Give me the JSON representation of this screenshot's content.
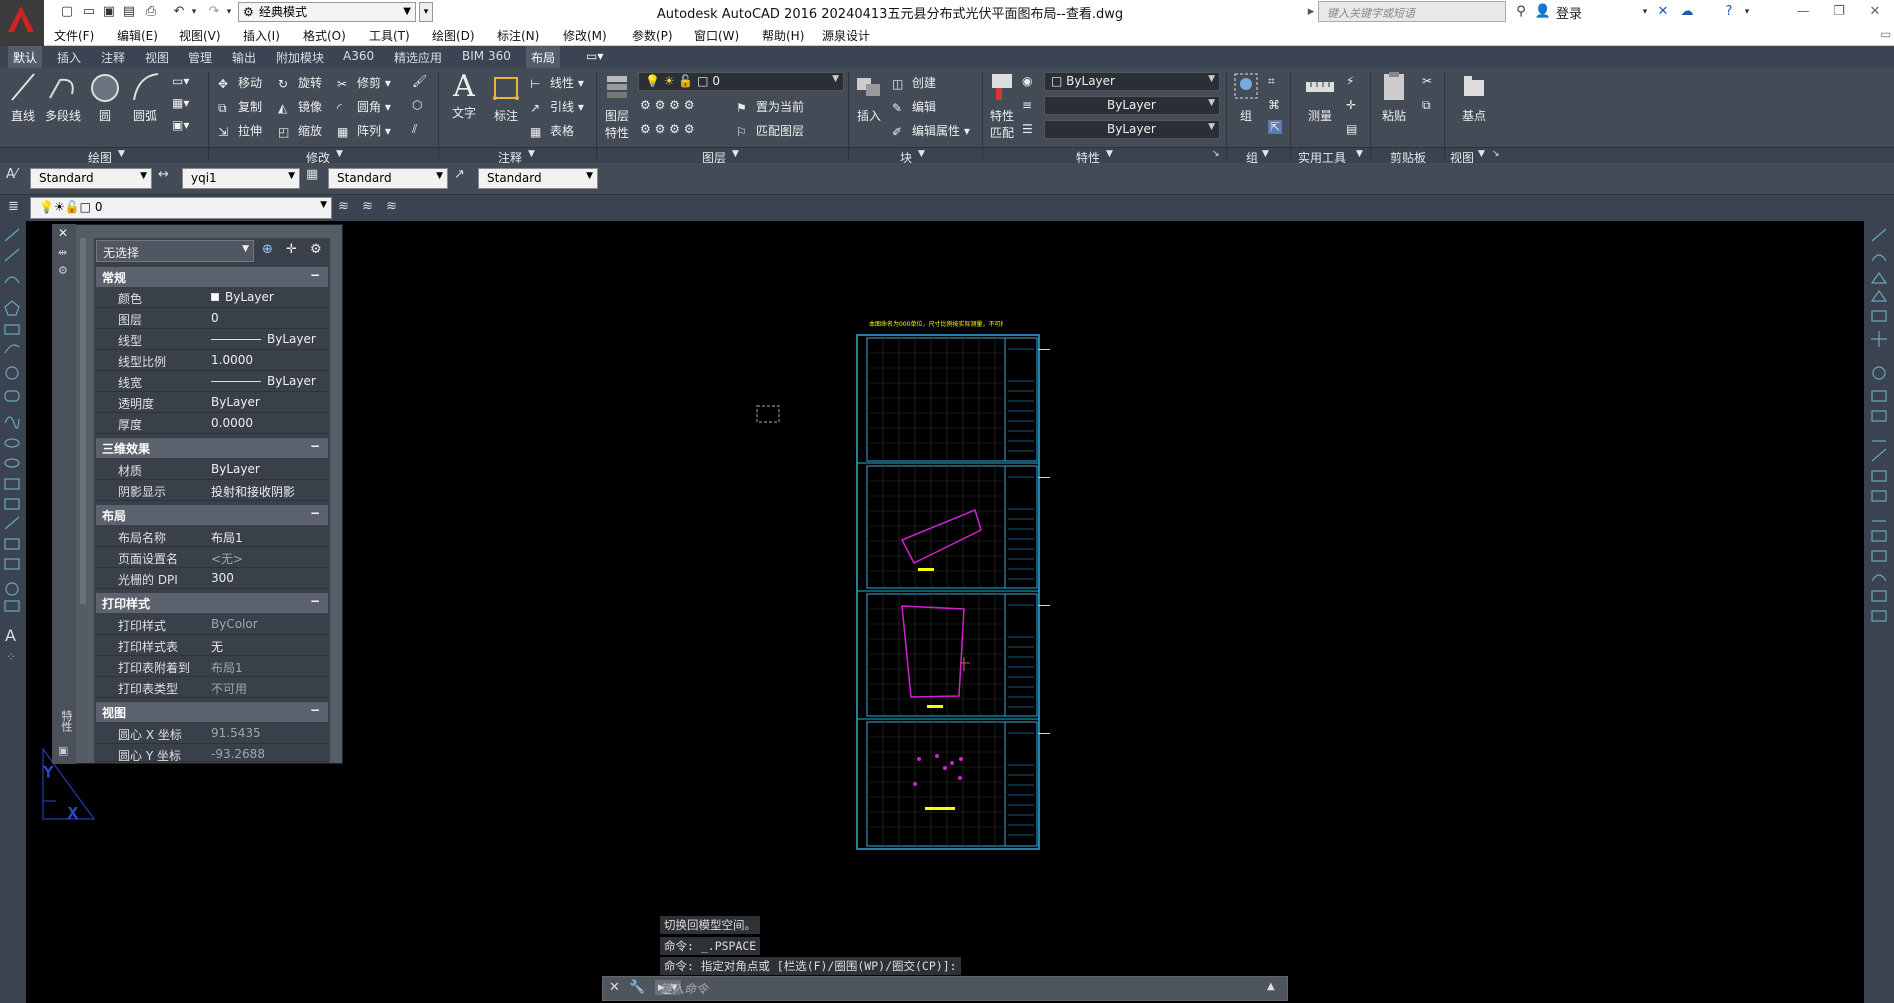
{
  "title_bar": {
    "workspace": "经典模式",
    "window_title": "Autodesk AutoCAD 2016    20240413五元县分布式光伏平面图布局--查看.dwg",
    "search_placeholder": "键入关键字或短语",
    "login": "登录"
  },
  "menu": [
    "文件(F)",
    "编辑(E)",
    "视图(V)",
    "插入(I)",
    "格式(O)",
    "工具(T)",
    "绘图(D)",
    "标注(N)",
    "修改(M)",
    "参数(P)",
    "窗口(W)",
    "帮助(H)",
    "源泉设计"
  ],
  "ribbon_tabs": [
    "默认",
    "插入",
    "注释",
    "视图",
    "管理",
    "输出",
    "附加模块",
    "A360",
    "精选应用",
    "BIM 360",
    "布局"
  ],
  "ribbon": {
    "draw": {
      "line": "直线",
      "polyline": "多段线",
      "circle": "圆",
      "arc": "圆弧",
      "group": "绘图"
    },
    "modify": {
      "move": "移动",
      "rotate": "旋转",
      "trim": "修剪",
      "copy": "复制",
      "mirror": "镜像",
      "fillet": "圆角",
      "stretch": "拉伸",
      "scale": "缩放",
      "array": "阵列",
      "group": "修改"
    },
    "annotation": {
      "text": "文字",
      "dimension": "标注",
      "linear": "线性",
      "leader": "引线",
      "table": "表格",
      "group": "注释"
    },
    "layers": {
      "layer_props": "图层",
      "layer_props2": "特性",
      "current_layer": "0",
      "make_current": "置为当前",
      "match_layer": "匹配图层",
      "group": "图层"
    },
    "block": {
      "insert": "插入",
      "create": "创建",
      "edit": "编辑",
      "edit_attr": "编辑属性",
      "group": "块"
    },
    "properties": {
      "match": "特性",
      "match2": "匹配",
      "color": "ByLayer",
      "linetype": "ByLayer",
      "lineweight": "ByLayer",
      "group": "特性"
    },
    "groups": {
      "group": "组",
      "group_label": "组"
    },
    "utilities": {
      "measure": "测量",
      "group": "实用工具"
    },
    "clipboard": {
      "paste": "粘贴",
      "group": "剪贴板"
    },
    "view": {
      "base": "基点",
      "group": "视图"
    }
  },
  "style_bar": {
    "text_style": "Standard",
    "dim_style": "yqi1",
    "table_style": "Standard",
    "mleader_style": "Standard"
  },
  "layer_bar": {
    "layer": "0"
  },
  "properties_panel": {
    "selection": "无选择",
    "sections": [
      {
        "name": "常规",
        "rows": [
          {
            "k": "颜色",
            "v": "ByLayer"
          },
          {
            "k": "图层",
            "v": "0"
          },
          {
            "k": "线型",
            "v": "ByLayer"
          },
          {
            "k": "线型比例",
            "v": "1.0000"
          },
          {
            "k": "线宽",
            "v": "ByLayer"
          },
          {
            "k": "透明度",
            "v": "ByLayer"
          },
          {
            "k": "厚度",
            "v": "0.0000"
          }
        ]
      },
      {
        "name": "三维效果",
        "rows": [
          {
            "k": "材质",
            "v": "ByLayer"
          },
          {
            "k": "阴影显示",
            "v": "投射和接收阴影"
          }
        ]
      },
      {
        "name": "布局",
        "rows": [
          {
            "k": "布局名称",
            "v": "布局1"
          },
          {
            "k": "页面设置名",
            "v": "<无>"
          },
          {
            "k": "光栅的 DPI",
            "v": "300"
          }
        ]
      },
      {
        "name": "打印样式",
        "rows": [
          {
            "k": "打印样式",
            "v": "ByColor"
          },
          {
            "k": "打印样式表",
            "v": "无"
          },
          {
            "k": "打印表附着到",
            "v": "布局1"
          },
          {
            "k": "打印表类型",
            "v": "不可用"
          }
        ]
      },
      {
        "name": "视图",
        "rows": [
          {
            "k": "圆心 X 坐标",
            "v": "91.5435"
          },
          {
            "k": "圆心 Y 坐标",
            "v": "-93.2688"
          }
        ]
      }
    ],
    "side_label": "特性"
  },
  "drawing": {
    "note_text": "本图命名为000单位，尺寸比例按实际测量，不可按比"
  },
  "command": {
    "history": [
      "切换回模型空间。",
      "命令: _.PSPACE",
      "命令: 指定对角点或 [栏选(F)/圈围(WP)/圈交(CP)]:"
    ],
    "placeholder": "键入命令"
  }
}
